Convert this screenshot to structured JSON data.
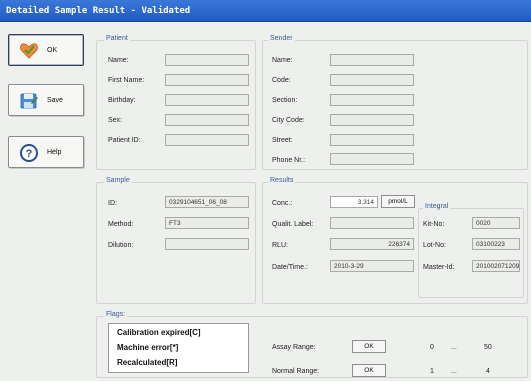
{
  "window": {
    "title": "Detailed Sample Result - Validated"
  },
  "sidebar": {
    "ok_label": "OK",
    "save_label": "Save",
    "help_label": "Help"
  },
  "patient": {
    "title": "Patient",
    "name_label": "Name:",
    "name_value": "",
    "first_name_label": "First Name:",
    "first_name_value": "",
    "birthday_label": "Birthday:",
    "birthday_value": "",
    "sex_label": "Sex:",
    "sex_value": "",
    "patient_id_label": "Patient ID:",
    "patient_id_value": ""
  },
  "sender": {
    "title": "Sender",
    "name_label": "Name:",
    "name_value": "",
    "code_label": "Code:",
    "code_value": "",
    "section_label": "Section:",
    "section_value": "",
    "city_code_label": "City Code:",
    "city_code_value": "",
    "street_label": "Street:",
    "street_value": "",
    "phone_label": "Phone Nr.:",
    "phone_value": ""
  },
  "sample": {
    "title": "Sample",
    "id_label": "ID:",
    "id_value": "0329104651_06_08",
    "method_label": "Method:",
    "method_value": "FT3",
    "dilution_label": "Dilution:",
    "dilution_value": ""
  },
  "results": {
    "title": "Results",
    "conc_label": "Conc.:",
    "conc_value": "3.314",
    "conc_unit": "pmol/L",
    "qualit_label": "Qualit. Label:",
    "qualit_value": "",
    "rlu_label": "RLU:",
    "rlu_value": "226374",
    "datetime_label": "Date/Time.:",
    "datetime_value": "2010-3-29"
  },
  "integral": {
    "title": "Integral",
    "kit_no_label": "Kit-No:",
    "kit_no_value": "0020",
    "lot_no_label": "Lot-No:",
    "lot_no_value": "03100223",
    "master_id_label": "Master-Id:",
    "master_id_value": "201002071209"
  },
  "flags": {
    "title": "Flags:",
    "items": [
      "Calibration expired[C]",
      "Machine error[*]",
      "Recalculated[R]"
    ]
  },
  "ranges": {
    "assay_label": "Assay Range:",
    "assay_status": "OK",
    "assay_low": "0",
    "assay_sep": "...",
    "assay_high": "50",
    "normal_label": "Normal Range:",
    "normal_status": "OK",
    "normal_low": "1",
    "normal_sep": "...",
    "normal_high": "4"
  },
  "colors": {
    "titlebar": "#2a66cc",
    "group_title": "#3a5a9c",
    "panel": "#eef0ee"
  },
  "icons": {
    "ok": "heart-check-icon",
    "save": "save-disk-icon",
    "help": "help-question-icon"
  }
}
